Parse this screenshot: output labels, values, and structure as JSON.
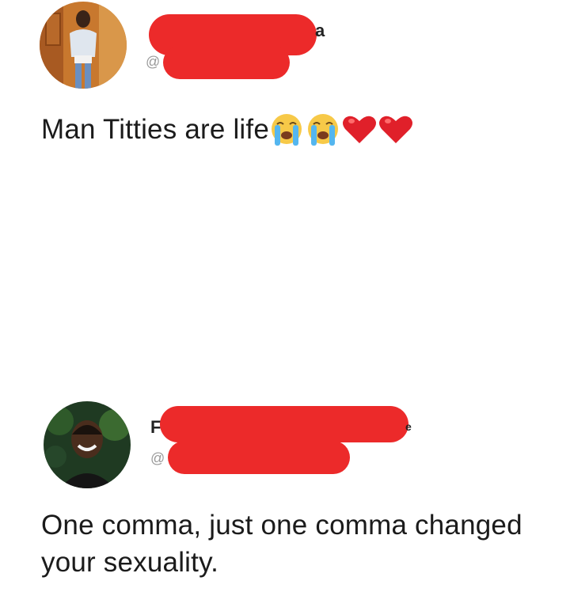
{
  "tweets": [
    {
      "name_visible": "a",
      "handle_visible": "@",
      "text": "Man Titties are life",
      "emojis": [
        "loudly-crying-face-icon",
        "loudly-crying-face-icon",
        "red-heart-icon",
        "red-heart-icon"
      ]
    },
    {
      "name_visible_start": "F",
      "name_visible_end": "e",
      "handle_visible": "@",
      "text": "One comma, just one comma changed your sexuality."
    }
  ],
  "colors": {
    "redaction": "#ec2a2a",
    "text": "#1b1b1b",
    "handle": "#999999"
  }
}
